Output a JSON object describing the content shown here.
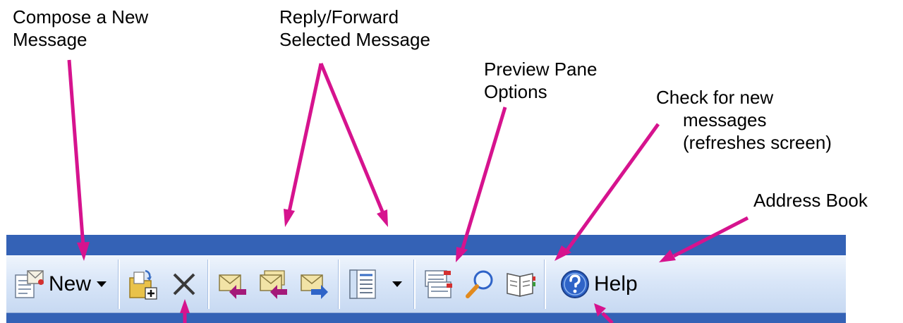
{
  "callouts": {
    "compose_line1": "Compose a New",
    "compose_line2": "Message",
    "reply_line1": "Reply/Forward",
    "reply_line2": "Selected Message",
    "preview_line1": "Preview Pane",
    "preview_line2": "Options",
    "check_line1": "Check for new",
    "check_line2": "messages",
    "check_line3": "(refreshes screen)",
    "address_book": "Address Book"
  },
  "toolbar": {
    "new_label": "New",
    "help_label": "Help"
  },
  "icons": {
    "new": "new-message-icon",
    "move": "move-to-folder-icon",
    "delete": "delete-x-icon",
    "reply": "reply-icon",
    "reply_all": "reply-all-icon",
    "forward": "forward-icon",
    "preview": "preview-pane-icon",
    "check": "check-messages-icon",
    "find": "find-magnifier-icon",
    "address_book": "address-book-icon",
    "help": "help-icon"
  },
  "colors": {
    "toolbar_band": "#3462b6",
    "arrow": "#d6138e"
  }
}
